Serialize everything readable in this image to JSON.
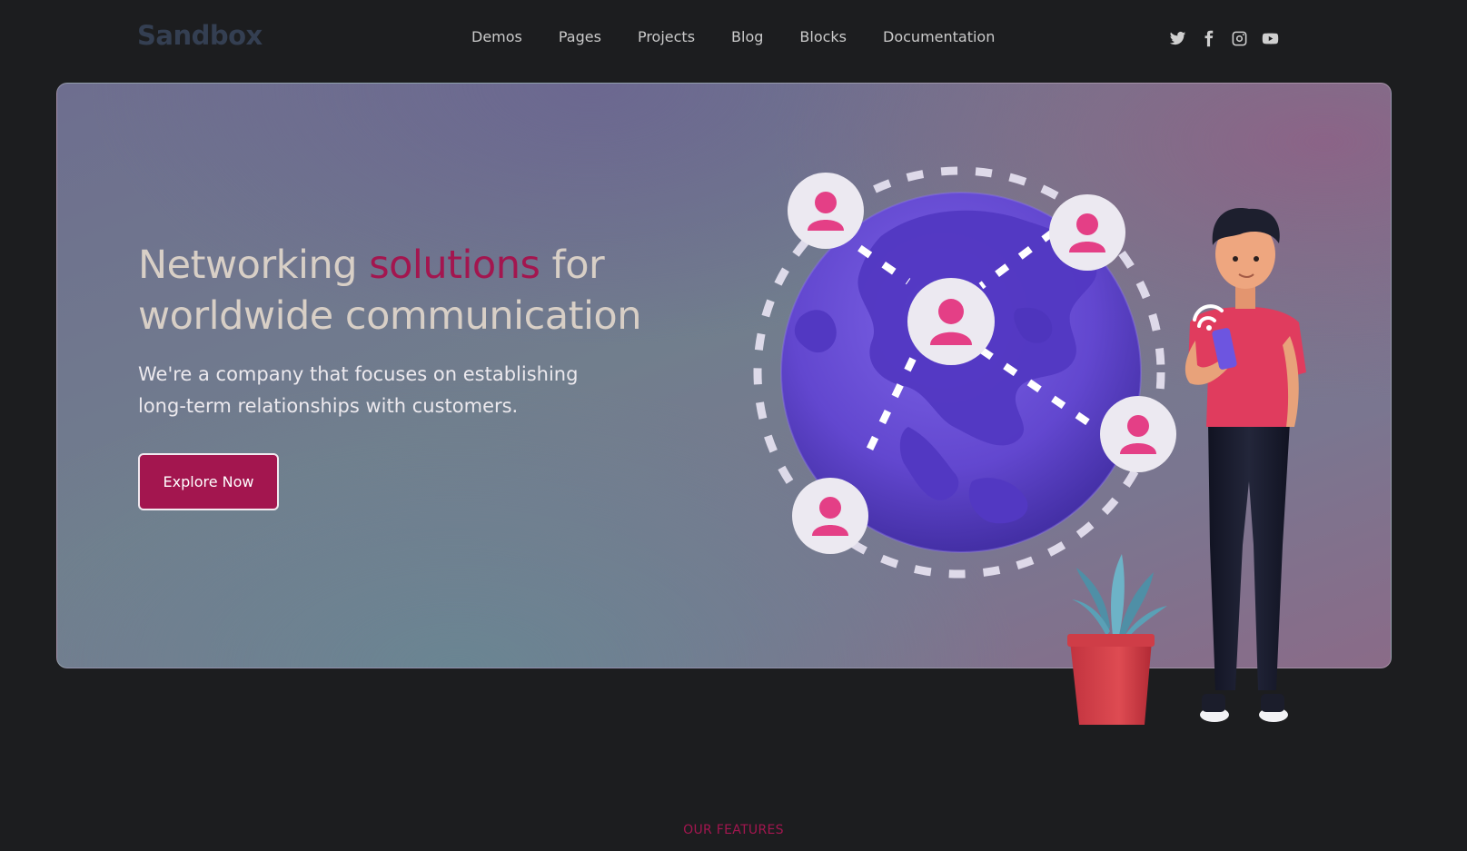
{
  "brand": {
    "logo_text": "Sandbox"
  },
  "nav": {
    "items": [
      {
        "label": "Demos"
      },
      {
        "label": "Pages"
      },
      {
        "label": "Projects"
      },
      {
        "label": "Blog"
      },
      {
        "label": "Blocks"
      },
      {
        "label": "Documentation"
      }
    ]
  },
  "social": [
    "twitter-icon",
    "facebook-icon",
    "instagram-icon",
    "youtube-icon"
  ],
  "hero": {
    "title_part1": "Networking ",
    "title_accent": "solutions",
    "title_part2": " for worldwide communication",
    "lead": "We're a company that focuses on establishing long-term relationships with customers.",
    "cta_label": "Explore Now"
  },
  "features": {
    "eyebrow": "OUR FEATURES"
  },
  "colors": {
    "background": "#1c1d1f",
    "accent": "#a3164f",
    "globe": "#6a4fd6",
    "user_pink": "#e43f86"
  }
}
